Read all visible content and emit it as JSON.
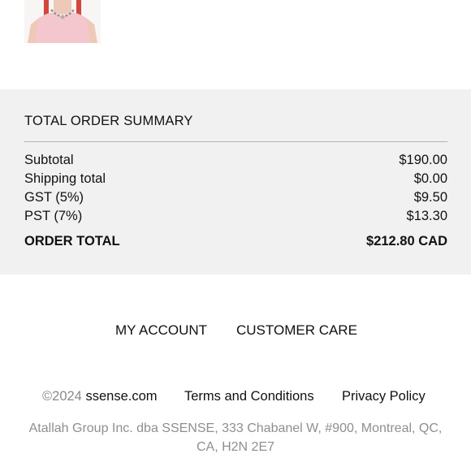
{
  "product": {
    "thumbnail_alt": "product-thumbnail"
  },
  "summary": {
    "title": "TOTAL ORDER SUMMARY",
    "rows": [
      {
        "label": "Subtotal",
        "value": "$190.00"
      },
      {
        "label": "Shipping total",
        "value": "$0.00"
      },
      {
        "label": "GST (5%)",
        "value": "$9.50"
      },
      {
        "label": "PST (7%)",
        "value": "$13.30"
      }
    ],
    "total": {
      "label": "ORDER TOTAL",
      "value": "$212.80 CAD"
    }
  },
  "footer": {
    "my_account": "MY ACCOUNT",
    "customer_care": "CUSTOMER CARE",
    "copyright_year": "©2024",
    "site": "ssense.com",
    "terms": "Terms and Conditions",
    "privacy": "Privacy Policy",
    "address_line1": "Atallah Group Inc. dba SSENSE, 333 Chabanel W, #900, Montreal, QC,",
    "address_line2": "CA, H2N 2E7"
  },
  "colors": {
    "panel_bg": "#f1f1f1",
    "text": "#111111",
    "muted_text": "#8f8f8f",
    "divider": "#b4b4b4"
  }
}
